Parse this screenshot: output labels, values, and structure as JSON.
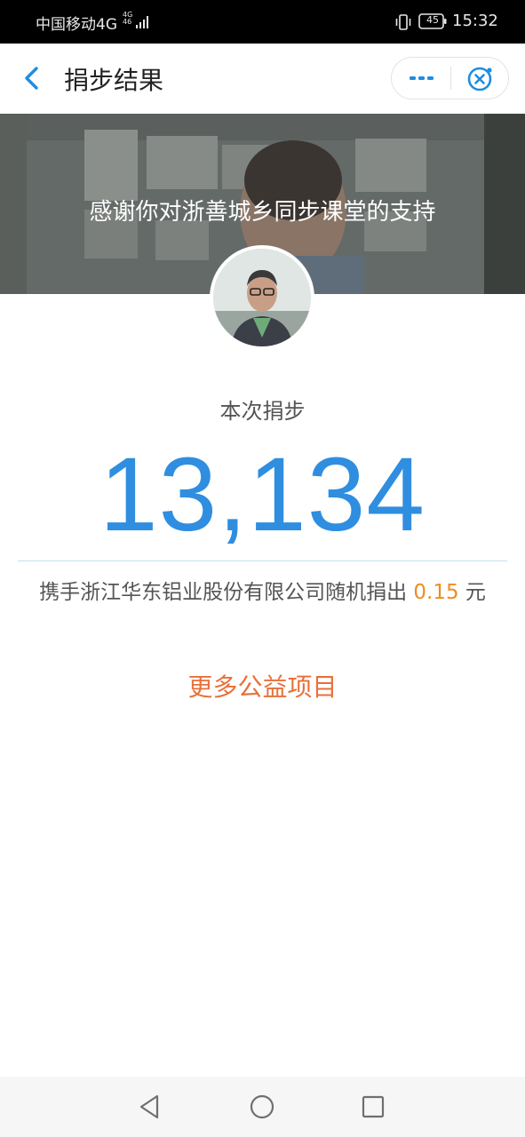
{
  "status_bar": {
    "carrier": "中国移动4G",
    "net_tag_top": "4G",
    "net_tag_bottom": "46",
    "battery": "45",
    "time": "15:32"
  },
  "nav": {
    "title": "捐步结果",
    "icons": [
      "back-icon",
      "more-icon",
      "close-icon"
    ],
    "accent": "#1e8de0"
  },
  "banner": {
    "text": "感谢你对浙善城乡同步课堂的支持"
  },
  "result": {
    "label": "本次捐步",
    "steps": "13,134",
    "donation_prefix": "携手浙江华东铝业股份有限公司随机捐出",
    "donation_amount": "0.15",
    "donation_suffix": "元",
    "more_link": "更多公益项目"
  },
  "colors": {
    "steps": "#2f8ee0",
    "amount": "#f08c1e",
    "more_link": "#e8703a"
  },
  "system_nav": {
    "icons": [
      "back-triangle-icon",
      "home-circle-icon",
      "recents-square-icon"
    ]
  }
}
